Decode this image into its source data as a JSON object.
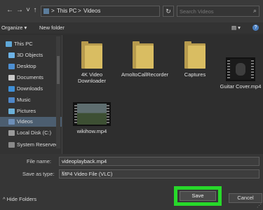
{
  "address": {
    "path": [
      "This PC",
      "Videos"
    ],
    "separators": [
      ">",
      ">"
    ],
    "search_placeholder": "Search Videos"
  },
  "icons": {
    "back": "back-arrow-icon",
    "forward": "forward-arrow-icon",
    "recent": "chevron-down-icon",
    "up": "up-arrow-icon",
    "refresh": "refresh-icon",
    "search": "search-icon"
  },
  "toolbar": {
    "organize": "Organize ▾",
    "new_folder": "New folder",
    "view": "▤ ▾",
    "help": "?"
  },
  "sidebar": {
    "items": [
      {
        "label": "This PC",
        "color": "#5fa8d8"
      },
      {
        "label": "3D Objects",
        "color": "#6db3e6"
      },
      {
        "label": "Desktop",
        "color": "#4d8fd1"
      },
      {
        "label": "Documents",
        "color": "#c9c9c9"
      },
      {
        "label": "Downloads",
        "color": "#3f8fd6"
      },
      {
        "label": "Music",
        "color": "#4f87c8"
      },
      {
        "label": "Pictures",
        "color": "#6cb0d8"
      },
      {
        "label": "Videos",
        "color": "#6d8fb8"
      },
      {
        "label": "Local Disk (C:)",
        "color": "#9a9a9a"
      },
      {
        "label": "System Reserved",
        "color": "#8a8a8a"
      }
    ]
  },
  "files": [
    {
      "name": "4K Video Downloader",
      "kind": "folder"
    },
    {
      "name": "AmoltoCallRecorder",
      "kind": "folder"
    },
    {
      "name": "Captures",
      "kind": "folder"
    },
    {
      "name": "Guitar Cover.mp4",
      "kind": "video"
    },
    {
      "name": "wikihow.mp4",
      "kind": "video"
    }
  ],
  "form": {
    "filename_label": "File name:",
    "filename_value": "videoplayback.mp4",
    "savetype_label": "Save as type:",
    "savetype_value": "MP4 Video File (VLC)"
  },
  "footer": {
    "hide_folders": "^ Hide Folders",
    "save": "Save",
    "cancel": "Cancel"
  },
  "colors": {
    "highlight": "#27d92a",
    "folder": "#d9bd62"
  }
}
